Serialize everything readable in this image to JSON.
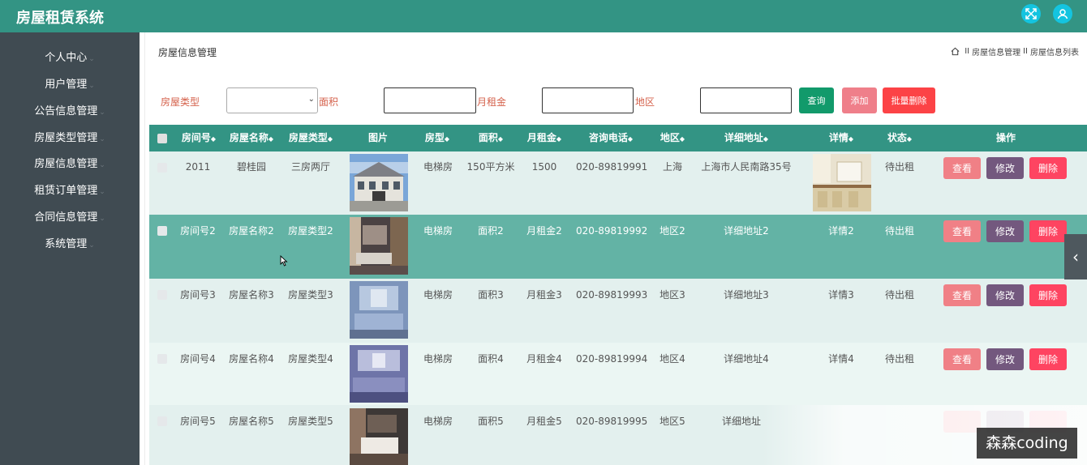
{
  "app": {
    "title": "房屋租赁系统"
  },
  "topbar": {
    "fullscreen_icon": "expand-arrows-icon",
    "user_icon": "user-icon",
    "accent": "#339484"
  },
  "sidebar": {
    "items": [
      {
        "label": "个人中心"
      },
      {
        "label": "用户管理"
      },
      {
        "label": "公告信息管理"
      },
      {
        "label": "房屋类型管理"
      },
      {
        "label": "房屋信息管理"
      },
      {
        "label": "租赁订单管理"
      },
      {
        "label": "合同信息管理"
      },
      {
        "label": "系统管理"
      }
    ]
  },
  "page": {
    "heading": "房屋信息管理",
    "breadcrumb": [
      "房屋信息管理",
      "房屋信息列表"
    ],
    "breadcrumb_sep": "II"
  },
  "filters": {
    "type_label": "房屋类型",
    "area_label": "面积",
    "rent_label": "月租金",
    "region_label": "地区",
    "type_value": "",
    "area_value": "",
    "rent_value": "",
    "region_value": ""
  },
  "buttons": {
    "search": "查询",
    "add": "添加",
    "batch_delete": "批量删除"
  },
  "table": {
    "columns": [
      "房间号",
      "房屋名称",
      "房屋类型",
      "图片",
      "房型",
      "面积",
      "月租金",
      "咨询电话",
      "地区",
      "详细地址",
      "详情",
      "状态",
      "操作"
    ],
    "actions": {
      "view": "查看",
      "edit": "修改",
      "delete": "删除"
    },
    "rows": [
      {
        "room": "2011",
        "name": "碧桂园",
        "type": "三房两厅",
        "style": "电梯房",
        "area": "150平方米",
        "rent": "1500",
        "phone": "020-89819991",
        "region": "上海",
        "address": "上海市人民南路35号",
        "detail": "",
        "status": "待出租",
        "detail_is_image": true
      },
      {
        "room": "房间号2",
        "name": "房屋名称2",
        "type": "房屋类型2",
        "style": "电梯房",
        "area": "面积2",
        "rent": "月租金2",
        "phone": "020-89819992",
        "region": "地区2",
        "address": "详细地址2",
        "detail": "详情2",
        "status": "待出租"
      },
      {
        "room": "房间号3",
        "name": "房屋名称3",
        "type": "房屋类型3",
        "style": "电梯房",
        "area": "面积3",
        "rent": "月租金3",
        "phone": "020-89819993",
        "region": "地区3",
        "address": "详细地址3",
        "detail": "详情3",
        "status": "待出租"
      },
      {
        "room": "房间号4",
        "name": "房屋名称4",
        "type": "房屋类型4",
        "style": "电梯房",
        "area": "面积4",
        "rent": "月租金4",
        "phone": "020-89819994",
        "region": "地区4",
        "address": "详细地址4",
        "detail": "详情4",
        "status": "待出租"
      },
      {
        "room": "房间号5",
        "name": "房屋名称5",
        "type": "房屋类型5",
        "style": "电梯房",
        "area": "面积5",
        "rent": "月租金5",
        "phone": "020-89819995",
        "region": "地区5",
        "address": "详细地址",
        "detail": "",
        "status": ""
      }
    ]
  },
  "watermark": "森森coding",
  "colors": {
    "header": "#339484",
    "sidebar": "#404b52",
    "label": "#d5624c",
    "search_btn": "#129a6b",
    "add_btn": "#ef7f8a",
    "batch_delete_btn": "#fc4346",
    "view_btn": "#f08086",
    "edit_btn": "#73587e",
    "delete_btn": "#fe4461",
    "row_even": "#e3f0ee",
    "row_odd": "#ebf6f3",
    "row_selected": "#63b3a5"
  }
}
